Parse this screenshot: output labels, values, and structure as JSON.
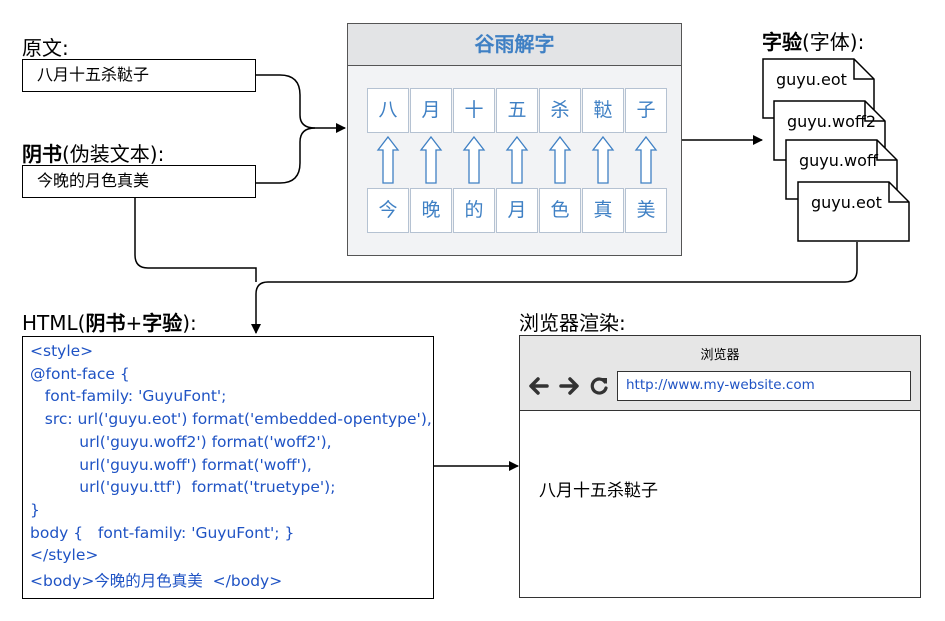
{
  "source": {
    "label": "原文:",
    "value": "八月十五杀鞑子"
  },
  "cover": {
    "label_bold": "阴书",
    "label_rest": "(伪装文本):",
    "value": "今晚的月色真美"
  },
  "guyu": {
    "title": "谷雨解字",
    "top_chars": [
      "八",
      "月",
      "十",
      "五",
      "杀",
      "鞑",
      "子"
    ],
    "bottom_chars": [
      "今",
      "晚",
      "的",
      "月",
      "色",
      "真",
      "美"
    ]
  },
  "fonts": {
    "label_bold": "字验",
    "label_rest": "(字体):",
    "files": [
      "guyu.eot",
      "guyu.woff2",
      "guyu.woff",
      "guyu.eot"
    ]
  },
  "html_section": {
    "label_pre": "HTML(",
    "label_bold1": "阴书",
    "label_plus": "+",
    "label_bold2": "字验",
    "label_post": "):",
    "code_lines": [
      "<style>",
      "@font-face {",
      "   font-family: 'GuyuFont';",
      "   src: url('guyu.eot') format('embedded-opentype'),",
      "          url('guyu.woff2') format('woff2'),",
      "          url('guyu.woff') format('woff'),",
      "          url('guyu.ttf')  format('truetype');",
      "}",
      "body {   font-family: 'GuyuFont'; }",
      "</style>",
      "<body>今晚的月色真美  </body>"
    ]
  },
  "browser_section": {
    "label": "浏览器渲染:",
    "window_title": "浏览器",
    "url": "http://www.my-website.com",
    "rendered_text": "八月十五杀鞑子"
  }
}
